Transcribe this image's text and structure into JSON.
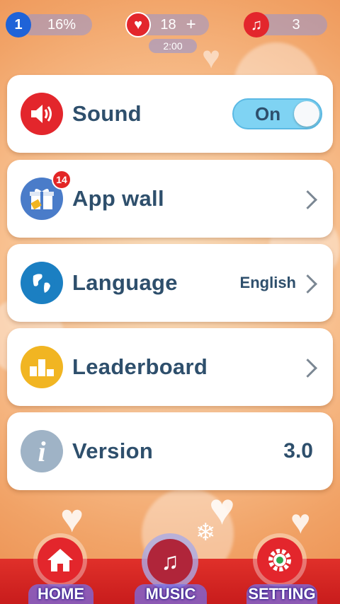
{
  "status": {
    "level": "1",
    "progress_text": "16%",
    "lives": "18",
    "add_symbol": "+",
    "timer": "2:00",
    "notes": "3"
  },
  "settings": {
    "sound": {
      "label": "Sound",
      "toggle": "On"
    },
    "app_wall": {
      "label": "App wall",
      "badge": "14"
    },
    "language": {
      "label": "Language",
      "value": "English"
    },
    "leaderboard": {
      "label": "Leaderboard"
    },
    "version": {
      "label": "Version",
      "value": "3.0"
    }
  },
  "nav": {
    "home": "HOME",
    "music": "MUSIC",
    "setting": "SETTING"
  },
  "icons": {
    "level": "level-badge-icon",
    "heart": "heart-icon",
    "note": "music-note-icon",
    "sound": "speaker-icon",
    "app_wall": "gift-icon",
    "language": "globe-icon",
    "leaderboard": "podium-icon",
    "version": "info-icon",
    "home": "house-icon",
    "music": "music-note-icon",
    "setting": "gear-icon"
  },
  "colors": {
    "sound_icon": "#e3262c",
    "app_wall_icon": "#4a7cc9",
    "language_icon": "#1b7fc2",
    "leaderboard_icon": "#f1b522",
    "version_icon": "#9fb3c6",
    "nav_bar": "#d8231f"
  }
}
